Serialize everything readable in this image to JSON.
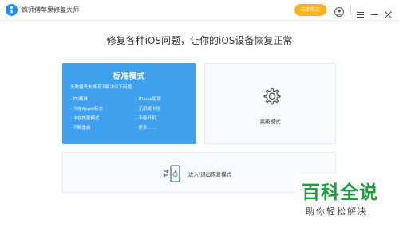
{
  "app": {
    "title": "疯师傅苹果修复大师",
    "buy_label": "立即购买"
  },
  "icons": {
    "logo": "app-logo-icon",
    "user": "user-icon",
    "menu": "menu-icon",
    "minimize": "minimize-icon",
    "close": "close-icon",
    "advanced": "gear-icon",
    "recovery": "phone-recovery-icon"
  },
  "headline": "修复各种iOS问题，让你的iOS设备恢复正常",
  "standard_mode": {
    "title": "标准模式",
    "desc": "无数据丢失情况下解决以下问题:",
    "left_items": [
      "· 白/黑屏",
      "· 卡在Apple标志",
      "· 卡在恢复模式",
      "· 不断重启"
    ],
    "right_items": [
      "· iTunes错误",
      "· 无机或卡住",
      "· 不能开机",
      "· 更多……"
    ]
  },
  "advanced_mode": {
    "label": "高级模式"
  },
  "recovery_mode": {
    "label": "进入/退出恢复模式"
  },
  "watermark": {
    "main": "百科全说",
    "sub": "助你轻松解决"
  },
  "colors": {
    "accent_blue": "#3ea0ef",
    "buy_orange": "#ffb21e",
    "card_bg": "#f6f9fd",
    "watermark_green": "#1e9c3e"
  }
}
